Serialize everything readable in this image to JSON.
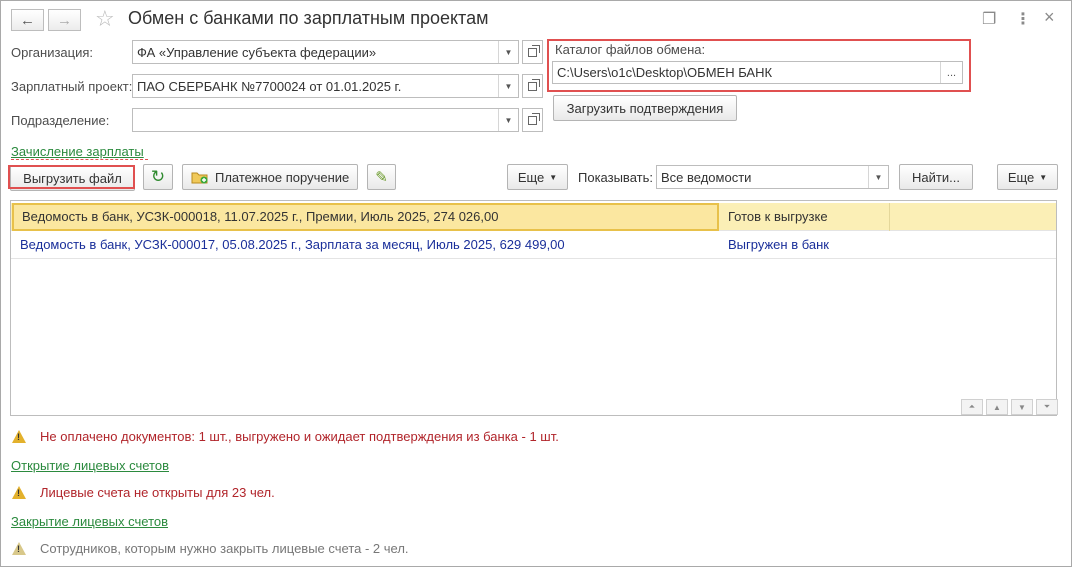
{
  "window": {
    "title": "Обмен с банками по зарплатным проектам",
    "back_icon": "←",
    "forward_icon": "→",
    "star_icon": "☆",
    "link_icon": "❐",
    "more_icon": "⋮",
    "close_icon": "×"
  },
  "form": {
    "organization_label": "Организация:",
    "organization_value": "ФА «Управление субъекта федерации»",
    "project_label": "Зарплатный проект:",
    "project_value": "ПАО СБЕРБАНК №7700024 от 01.01.2025 г.",
    "department_label": "Подразделение:",
    "department_value": "",
    "catalog_label": "Каталог файлов обмена:",
    "catalog_value": "C:\\Users\\o1c\\Desktop\\ОБМЕН БАНК",
    "catalog_browse": "...",
    "load_confirmations": "Загрузить подтверждения"
  },
  "section_salary": "Зачисление зарплаты",
  "toolbar": {
    "export_file": "Выгрузить файл",
    "refresh_icon": "↻",
    "payment_order": "Платежное поручение",
    "edit_icon": "✎",
    "more1": "Еще",
    "show_label": "Показывать:",
    "show_value": "Все ведомости",
    "find": "Найти...",
    "more2": "Еще"
  },
  "table": {
    "rows": [
      {
        "doc": "Ведомость в банк, УСЗК-000018, 11.07.2025 г., Премии, Июль 2025, 274 026,00",
        "status": "Готов к выгрузке"
      },
      {
        "doc": "Ведомость в банк, УСЗК-000017, 05.08.2025 г., Зарплата за месяц, Июль 2025, 629 499,00",
        "status": "Выгружен в банк"
      }
    ]
  },
  "messages": {
    "not_paid": "Не оплачено документов: 1 шт., выгружено и ожидает подтверждения из банка - 1 шт.",
    "open_accounts_link": "Открытие лицевых счетов",
    "accounts_not_open": "Лицевые счета не открыты для 23 чел.",
    "close_accounts_link": "Закрытие лицевых счетов",
    "close_needed": "Сотрудников, которым нужно закрыть лицевые счета - 2 чел."
  },
  "colors": {
    "highlight_frame": "#e05050",
    "selected_row": "#fbefb6",
    "link_green": "#2b8a3e",
    "warning_red": "#b1252b",
    "row_text_blue": "#1a2f9a"
  }
}
